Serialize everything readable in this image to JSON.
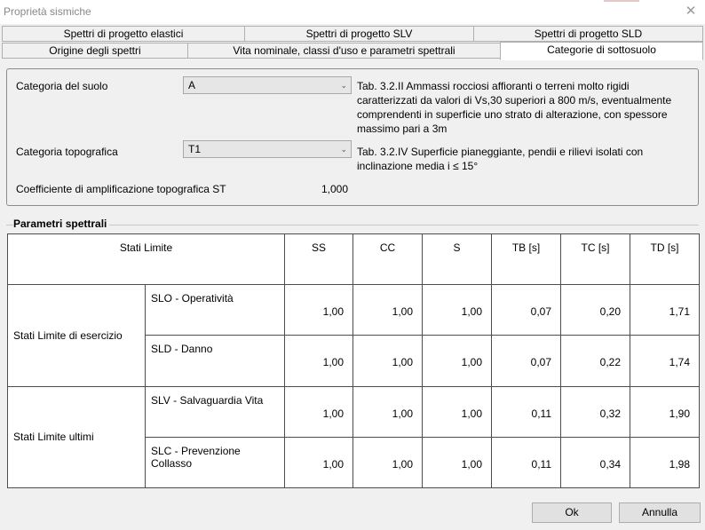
{
  "window": {
    "title": "Proprietà sismiche"
  },
  "tabs": {
    "row1": [
      "Spettri di progetto elastici",
      "Spettri di progetto SLV",
      "Spettri di progetto SLD"
    ],
    "row2": [
      "Origine degli spettri",
      "Vita nominale, classi d'uso e parametri spettrali",
      "Categorie di sottosuolo"
    ],
    "active": "Categorie di sottosuolo"
  },
  "soil": {
    "category_label": "Categoria del suolo",
    "category_value": "A",
    "category_desc": [
      "Tab. 3.2.II Ammassi rocciosi affioranti o terreni molto rigidi",
      "caratterizzati da valori di Vs,30 superiori a 800 m/s, eventualmente",
      "comprendenti in superficie uno strato di alterazione, con spessore",
      "massimo pari a 3m"
    ],
    "topo_label": "Categoria topografica",
    "topo_value": "T1",
    "topo_desc": [
      "Tab. 3.2.IV Superficie pianeggiante, pendii e rilievi isolati con",
      "inclinazione media i ≤ 15°"
    ],
    "coef_label": "Coefficiente di amplificazione topografica ST",
    "coef_value": "1,000"
  },
  "spectral": {
    "title": "Parametri spettrali",
    "headers": [
      "Stati Limite",
      "SS",
      "CC",
      "S",
      "TB [s]",
      "TC [s]",
      "TD [s]"
    ],
    "groups": [
      {
        "label": "Stati Limite di esercizio",
        "rows": [
          {
            "label": "SLO - Operatività",
            "values": [
              "1,00",
              "1,00",
              "1,00",
              "0,07",
              "0,20",
              "1,71"
            ]
          },
          {
            "label": "SLD - Danno",
            "values": [
              "1,00",
              "1,00",
              "1,00",
              "0,07",
              "0,22",
              "1,74"
            ]
          }
        ]
      },
      {
        "label": "Stati Limite ultimi",
        "rows": [
          {
            "label": "SLV - Salvaguardia Vita",
            "values": [
              "1,00",
              "1,00",
              "1,00",
              "0,11",
              "0,32",
              "1,90"
            ]
          },
          {
            "label": "SLC - Prevenzione Collasso",
            "values": [
              "1,00",
              "1,00",
              "1,00",
              "0,11",
              "0,34",
              "1,98"
            ]
          }
        ]
      }
    ]
  },
  "buttons": {
    "ok": "Ok",
    "cancel": "Annulla"
  }
}
